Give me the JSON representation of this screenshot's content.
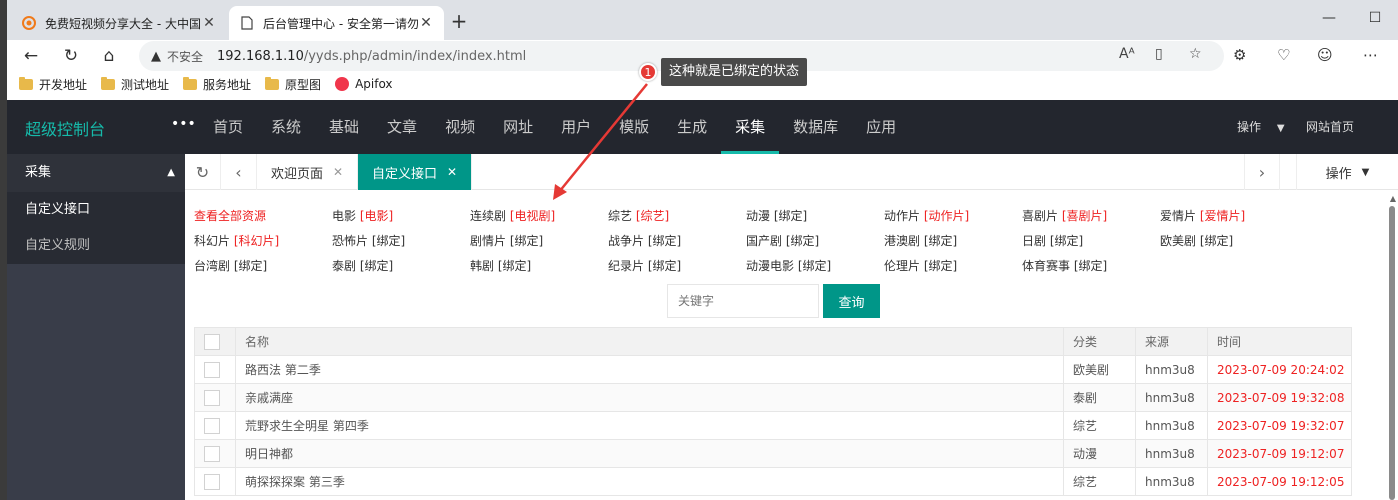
{
  "browser": {
    "tabs": [
      {
        "title": "免费短视频分享大全 - 大中国",
        "active": false
      },
      {
        "title": "后台管理中心 - 安全第一请勿泄露",
        "active": true
      }
    ],
    "insecure_label": "不安全",
    "url_host": "192.168.1.10",
    "url_path": "/yyds.php/admin/index/index.html",
    "bookmarks": [
      "开发地址",
      "测试地址",
      "服务地址",
      "原型图",
      "Apifox"
    ]
  },
  "header": {
    "logo": "超级控制台",
    "menu": [
      "首页",
      "系统",
      "基础",
      "文章",
      "视频",
      "网址",
      "用户",
      "模版",
      "生成",
      "采集",
      "数据库",
      "应用"
    ],
    "active_menu": "采集",
    "operate": "操作",
    "site_home": "网站首页"
  },
  "sidebar": {
    "section": "采集",
    "items": [
      "自定义接口",
      "自定义规则"
    ]
  },
  "page_tabs": {
    "tabs": [
      "欢迎页面",
      "自定义接口"
    ],
    "operate": "操作"
  },
  "categories": [
    [
      {
        "name": "查看全部资源",
        "tag": ""
      },
      {
        "name": "电影",
        "tag": "[电影]"
      },
      {
        "name": "连续剧",
        "tag": "[电视剧]"
      },
      {
        "name": "综艺",
        "tag": "[综艺]"
      },
      {
        "name": "动漫",
        "tag": "[绑定]"
      },
      {
        "name": "动作片",
        "tag": "[动作片]"
      },
      {
        "name": "喜剧片",
        "tag": "[喜剧片]"
      },
      {
        "name": "爱情片",
        "tag": "[爱情片]"
      }
    ],
    [
      {
        "name": "科幻片",
        "tag": "[科幻片]"
      },
      {
        "name": "恐怖片",
        "tag": "[绑定]"
      },
      {
        "name": "剧情片",
        "tag": "[绑定]"
      },
      {
        "name": "战争片",
        "tag": "[绑定]"
      },
      {
        "name": "国产剧",
        "tag": "[绑定]"
      },
      {
        "name": "港澳剧",
        "tag": "[绑定]"
      },
      {
        "name": "日剧",
        "tag": "[绑定]"
      },
      {
        "name": "欧美剧",
        "tag": "[绑定]"
      }
    ],
    [
      {
        "name": "台湾剧",
        "tag": "[绑定]"
      },
      {
        "name": "泰剧",
        "tag": "[绑定]"
      },
      {
        "name": "韩剧",
        "tag": "[绑定]"
      },
      {
        "name": "纪录片",
        "tag": "[绑定]"
      },
      {
        "name": "动漫电影",
        "tag": "[绑定]"
      },
      {
        "name": "伦理片",
        "tag": "[绑定]"
      },
      {
        "name": "体育赛事",
        "tag": "[绑定]"
      }
    ]
  ],
  "search": {
    "placeholder": "关键字",
    "button": "查询"
  },
  "table": {
    "headers": [
      "名称",
      "分类",
      "来源",
      "时间"
    ],
    "rows": [
      {
        "name": "路西法 第二季",
        "category": "欧美剧",
        "source": "hnm3u8",
        "time": "2023-07-09 20:24:02"
      },
      {
        "name": "亲戚满座",
        "category": "泰剧",
        "source": "hnm3u8",
        "time": "2023-07-09 19:32:08"
      },
      {
        "name": "荒野求生全明星 第四季",
        "category": "综艺",
        "source": "hnm3u8",
        "time": "2023-07-09 19:32:07"
      },
      {
        "name": "明日神都",
        "category": "动漫",
        "source": "hnm3u8",
        "time": "2023-07-09 19:12:07"
      },
      {
        "name": "萌探探探案 第三季",
        "category": "综艺",
        "source": "hnm3u8",
        "time": "2023-07-09 19:12:05"
      }
    ]
  },
  "annotation": {
    "number": "1",
    "text": "这种就是已绑定的状态"
  },
  "colors": {
    "accent": "#009688",
    "logo": "#16baaa",
    "header_bg": "#23262e",
    "sidebar_bg": "#393d49",
    "red": "#e22222"
  }
}
